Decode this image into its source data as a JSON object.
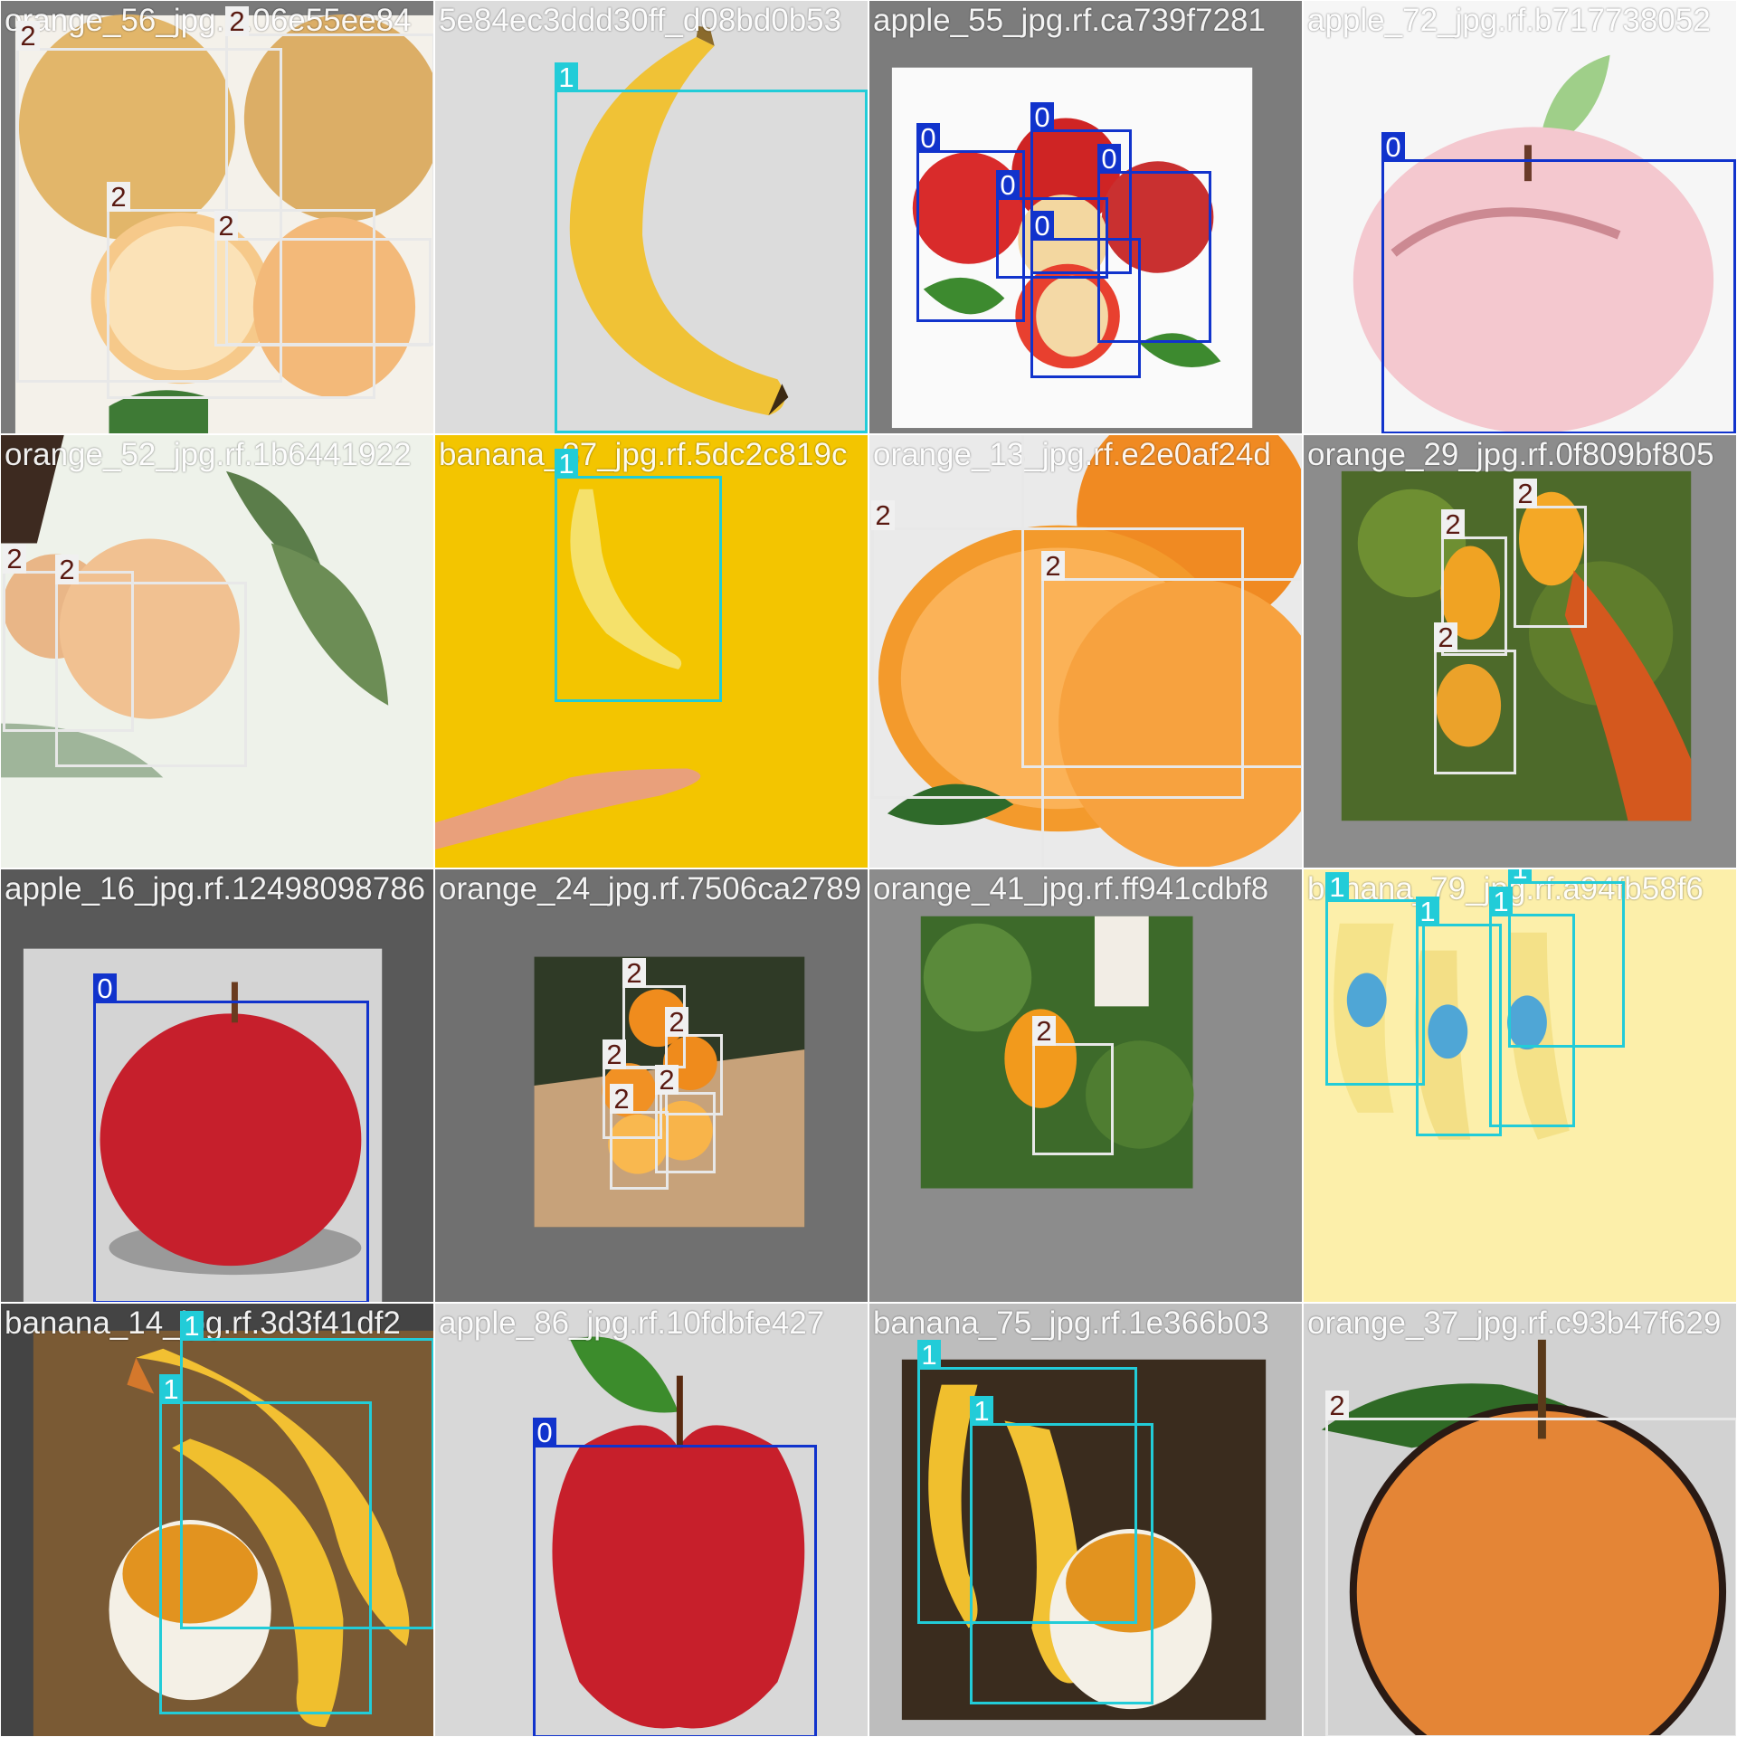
{
  "tiles": [
    {
      "title": "orange_56_jpg.rf.06e55ee84",
      "boxes": [
        {
          "cls": "2"
        },
        {
          "cls": "2"
        },
        {
          "cls": "2"
        },
        {
          "cls": "2"
        }
      ]
    },
    {
      "title": "5e84ec3ddd30ff_d08bd0b53",
      "boxes": [
        {
          "cls": "1"
        }
      ]
    },
    {
      "title": "apple_55_jpg.rf.ca739f7281",
      "boxes": [
        {
          "cls": "0"
        },
        {
          "cls": "0"
        },
        {
          "cls": "0"
        },
        {
          "cls": "0"
        },
        {
          "cls": "0"
        }
      ]
    },
    {
      "title": "apple_72_jpg.rf.b717738052",
      "boxes": [
        {
          "cls": "0"
        }
      ]
    },
    {
      "title": "orange_52_jpg.rf.1b6441922",
      "boxes": [
        {
          "cls": "2"
        },
        {
          "cls": "2"
        }
      ]
    },
    {
      "title": "banana_87_jpg.rf.5dc2c819c",
      "boxes": [
        {
          "cls": "1"
        }
      ]
    },
    {
      "title": "orange_13_jpg.rf.e2e0af24d",
      "boxes": [
        {
          "cls": "2"
        },
        {
          "cls": "2"
        },
        {
          "cls": "2"
        }
      ]
    },
    {
      "title": "orange_29_jpg.rf.0f809bf805",
      "boxes": [
        {
          "cls": "2"
        },
        {
          "cls": "2"
        },
        {
          "cls": "2"
        }
      ]
    },
    {
      "title": "apple_16_jpg.rf.12498098786",
      "boxes": [
        {
          "cls": "0"
        }
      ]
    },
    {
      "title": "orange_24_jpg.rf.7506ca2789",
      "boxes": [
        {
          "cls": "2"
        },
        {
          "cls": "2"
        },
        {
          "cls": "2"
        },
        {
          "cls": "2"
        },
        {
          "cls": "2"
        }
      ]
    },
    {
      "title": "orange_41_jpg.rf.ff941cdbf8",
      "boxes": [
        {
          "cls": "2"
        }
      ]
    },
    {
      "title": "banana_79_jpg.rf.a94fb58f6",
      "boxes": [
        {
          "cls": "1"
        },
        {
          "cls": "1"
        },
        {
          "cls": "1"
        },
        {
          "cls": "1"
        }
      ]
    },
    {
      "title": "banana_14_jpg.rf.3d3f41df2",
      "boxes": [
        {
          "cls": "1"
        },
        {
          "cls": "1"
        }
      ]
    },
    {
      "title": "apple_86_jpg.rf.10fdbfe427",
      "boxes": [
        {
          "cls": "0"
        }
      ]
    },
    {
      "title": "banana_75_jpg.rf.1e366b03",
      "boxes": [
        {
          "cls": "1"
        },
        {
          "cls": "1"
        }
      ]
    },
    {
      "title": "orange_37_jpg.rf.c93b47f629",
      "boxes": [
        {
          "cls": "2"
        }
      ]
    }
  ],
  "class_colors": {
    "0": "#1133cc",
    "1": "#22ccd8",
    "2": "#e8e8e8"
  }
}
